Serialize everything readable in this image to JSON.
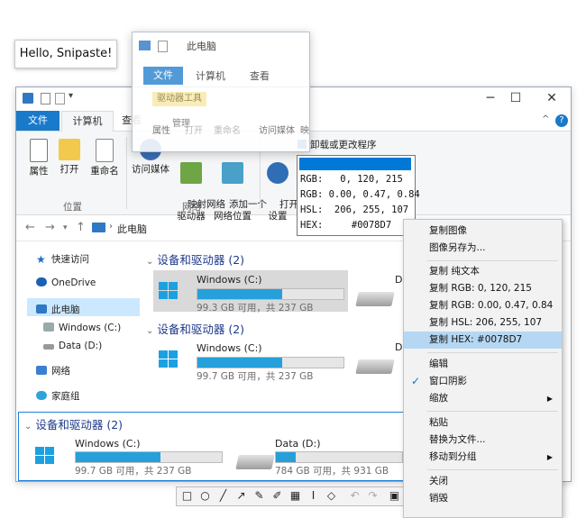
{
  "hello_tooltip": "Hello, Snipaste!",
  "ghost_window": {
    "title": "此电脑",
    "tabs": [
      "文件",
      "计算机",
      "查看"
    ],
    "context_tab": "驱动器工具",
    "manage_tab": "管理",
    "buttons": [
      "属性",
      "打开",
      "重命名",
      "访问媒体",
      "映"
    ]
  },
  "window": {
    "controls": [
      "─",
      "☐",
      "✕"
    ],
    "tabs": {
      "file": "文件",
      "computer": "计算机",
      "view": "查看"
    },
    "ribbon": {
      "btn_props": "属性",
      "btn_open": "打开",
      "btn_rename": "重命名",
      "btn_media": "访问媒体",
      "btn_map": "映射网络\n驱动器",
      "btn_addloc": "添加一个\n网络位置",
      "btn_open_settings": "打开\n设置",
      "uninstall": "卸载或更改程序",
      "group_location": "位置",
      "group_network": "网络"
    },
    "address": {
      "path": "此电脑"
    },
    "sidebar": [
      {
        "label": "快速访问"
      },
      {
        "label": "OneDrive"
      },
      {
        "label": "此电脑"
      },
      {
        "label": "Windows (C:)"
      },
      {
        "label": "Data (D:)"
      },
      {
        "label": "网络"
      },
      {
        "label": "家庭组"
      }
    ],
    "section_title": "设备和驱动器 (2)",
    "drives": [
      {
        "name": "Windows (C:)",
        "sub": "99.3 GB 可用，共 237 GB",
        "used_fraction": 0.58
      },
      {
        "name": "Windows (C:)",
        "sub": "99.7 GB 可用，共 237 GB",
        "used_fraction": 0.58
      },
      {
        "name": "D"
      },
      {
        "name": "D"
      }
    ]
  },
  "snip": {
    "section_title": "设备和驱动器 (2)",
    "drives": [
      {
        "name": "Windows (C:)",
        "sub": "99.7 GB 可用，共 237 GB",
        "used_fraction": 0.58
      },
      {
        "name": "Data (D:)",
        "sub": "784 GB 可用，共 931 GB",
        "used_fraction": 0.16
      }
    ]
  },
  "color_info": {
    "swatch_color": "#0078D7",
    "rgb_int": "RGB:   0, 120, 215",
    "rgb_float": "RGB: 0.00, 0.47, 0.84",
    "hsl": "HSL:  206, 255, 107",
    "hex": "HEX:     #0078D7"
  },
  "context_menu": {
    "copy_image": "复制图像",
    "save_image_as": "图像另存为...",
    "copy_text": "复制 纯文本",
    "copy_rgb": "复制 RGB: 0, 120, 215",
    "copy_rgbf": "复制 RGB: 0.00, 0.47, 0.84",
    "copy_hsl": "复制 HSL: 206, 255, 107",
    "copy_hex": "复制 HEX: #0078D7",
    "edit": "编辑",
    "shadow": "窗口阴影",
    "zoom": "缩放",
    "paste": "粘贴",
    "replace_file": "替换为文件...",
    "move_group": "移动到分组",
    "close": "关闭",
    "destroy": "销毁"
  },
  "toolbar_icons": [
    "rectangle-icon",
    "ellipse-icon",
    "line-icon",
    "arrow-icon",
    "pencil-icon",
    "marker-icon",
    "mosaic-icon",
    "text-icon",
    "eraser-icon",
    "undo-icon",
    "redo-icon",
    "save-icon"
  ]
}
